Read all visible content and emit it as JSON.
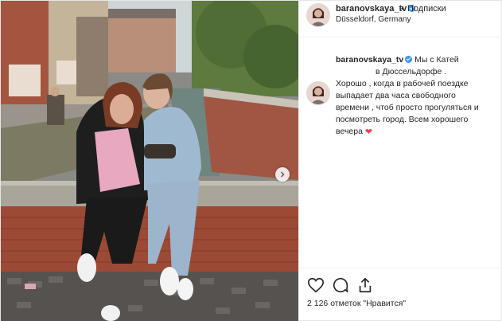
{
  "header": {
    "username": "baranovskaya_tv",
    "follow_label": "Подписки",
    "location": "Düsseldorf, Germany"
  },
  "caption": {
    "username": "baranovskaya_tv",
    "line1_text": "Мы с Катей",
    "line2_text": "в Дюссельдорфе .",
    "line3_text": "Хорошо , когда в рабочей поездке",
    "line4_text": "выпадает два часа свободного",
    "line5_text": "времени , чтоб просто прогуляться и",
    "line6_text": "посмотреть город. Всем хорошего",
    "line7_text": "вечера"
  },
  "stats": {
    "likes_text": "2 126 отметок \"Нравится\""
  },
  "colors": {
    "accent_blue": "#3897f0",
    "heart_red": "#ed4956",
    "text": "#262626",
    "border": "#efefef"
  },
  "icons": {
    "like": "heart-outline-icon",
    "comment": "comment-bubble-icon",
    "share": "share-upload-icon",
    "next": "chevron-right-icon",
    "verified": "verified-badge-icon"
  }
}
